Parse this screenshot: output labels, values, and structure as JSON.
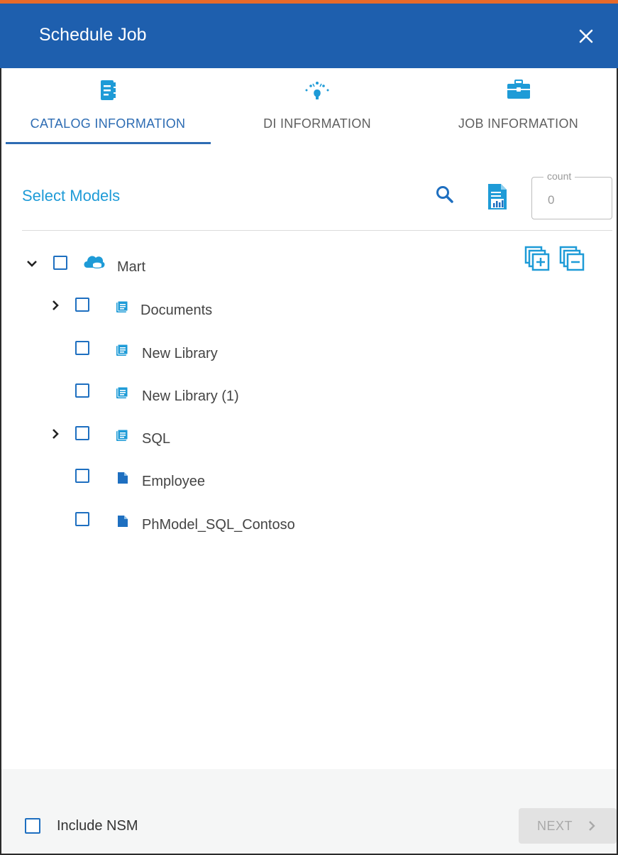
{
  "dialog": {
    "title": "Schedule Job",
    "close_icon": "close-icon"
  },
  "tabs": [
    {
      "label": "CATALOG INFORMATION",
      "icon": "catalog-icon",
      "active": true
    },
    {
      "label": "DI INFORMATION",
      "icon": "di-sparkle-icon",
      "active": false
    },
    {
      "label": "JOB INFORMATION",
      "icon": "briefcase-icon",
      "active": false
    }
  ],
  "models": {
    "title": "Select Models",
    "search_icon": "search-icon",
    "report_icon": "report-icon",
    "count_label": "count",
    "count_value": "0",
    "expand_all_icon": "expand-all-icon",
    "collapse_all_icon": "collapse-all-icon"
  },
  "tree": [
    {
      "label": "Mart",
      "icon": "cloud-database-icon",
      "expanded": true,
      "has_children": true
    },
    {
      "label": "Documents",
      "icon": "library-icon",
      "expanded": false,
      "has_children": true
    },
    {
      "label": "New Library",
      "icon": "library-icon",
      "has_children": false
    },
    {
      "label": "New Library (1)",
      "icon": "library-icon",
      "has_children": false
    },
    {
      "label": "SQL",
      "icon": "library-icon",
      "expanded": false,
      "has_children": true
    },
    {
      "label": "Employee",
      "icon": "file-icon",
      "has_children": false
    },
    {
      "label": "PhModel_SQL_Contoso",
      "icon": "file-icon",
      "has_children": false
    }
  ],
  "footer": {
    "include_nsm_label": "Include NSM",
    "next_label": "NEXT"
  },
  "colors": {
    "header_bg": "#1e5fae",
    "accent": "#1e9bd7",
    "tab_active": "#2d6cb3",
    "checkbox": "#1e6fc0",
    "top_strip": "#e86a2a"
  }
}
